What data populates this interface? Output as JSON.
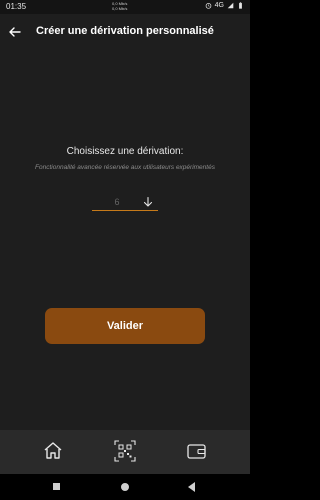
{
  "status": {
    "time": "01:35",
    "net_up": "0,0 Mb/s",
    "net_down": "0,0 Mb/s",
    "network": "4G"
  },
  "header": {
    "title": "Créer une dérivation personnalisé",
    "back_icon": "arrow-left-icon"
  },
  "main": {
    "prompt": "Choisissez une dérivation:",
    "subprompt": "Fonctionnalité avancée réservée aux utilisateurs expérimentés",
    "derivation_value": "6",
    "dropdown_icon": "arrow-down-icon",
    "submit_label": "Valider"
  },
  "bottom_nav": {
    "items": [
      "home-icon",
      "qr-code-icon",
      "wallet-icon"
    ]
  },
  "colors": {
    "accent": "#c67a1a",
    "button": "#8a4a10",
    "background": "#1e1e1e"
  }
}
